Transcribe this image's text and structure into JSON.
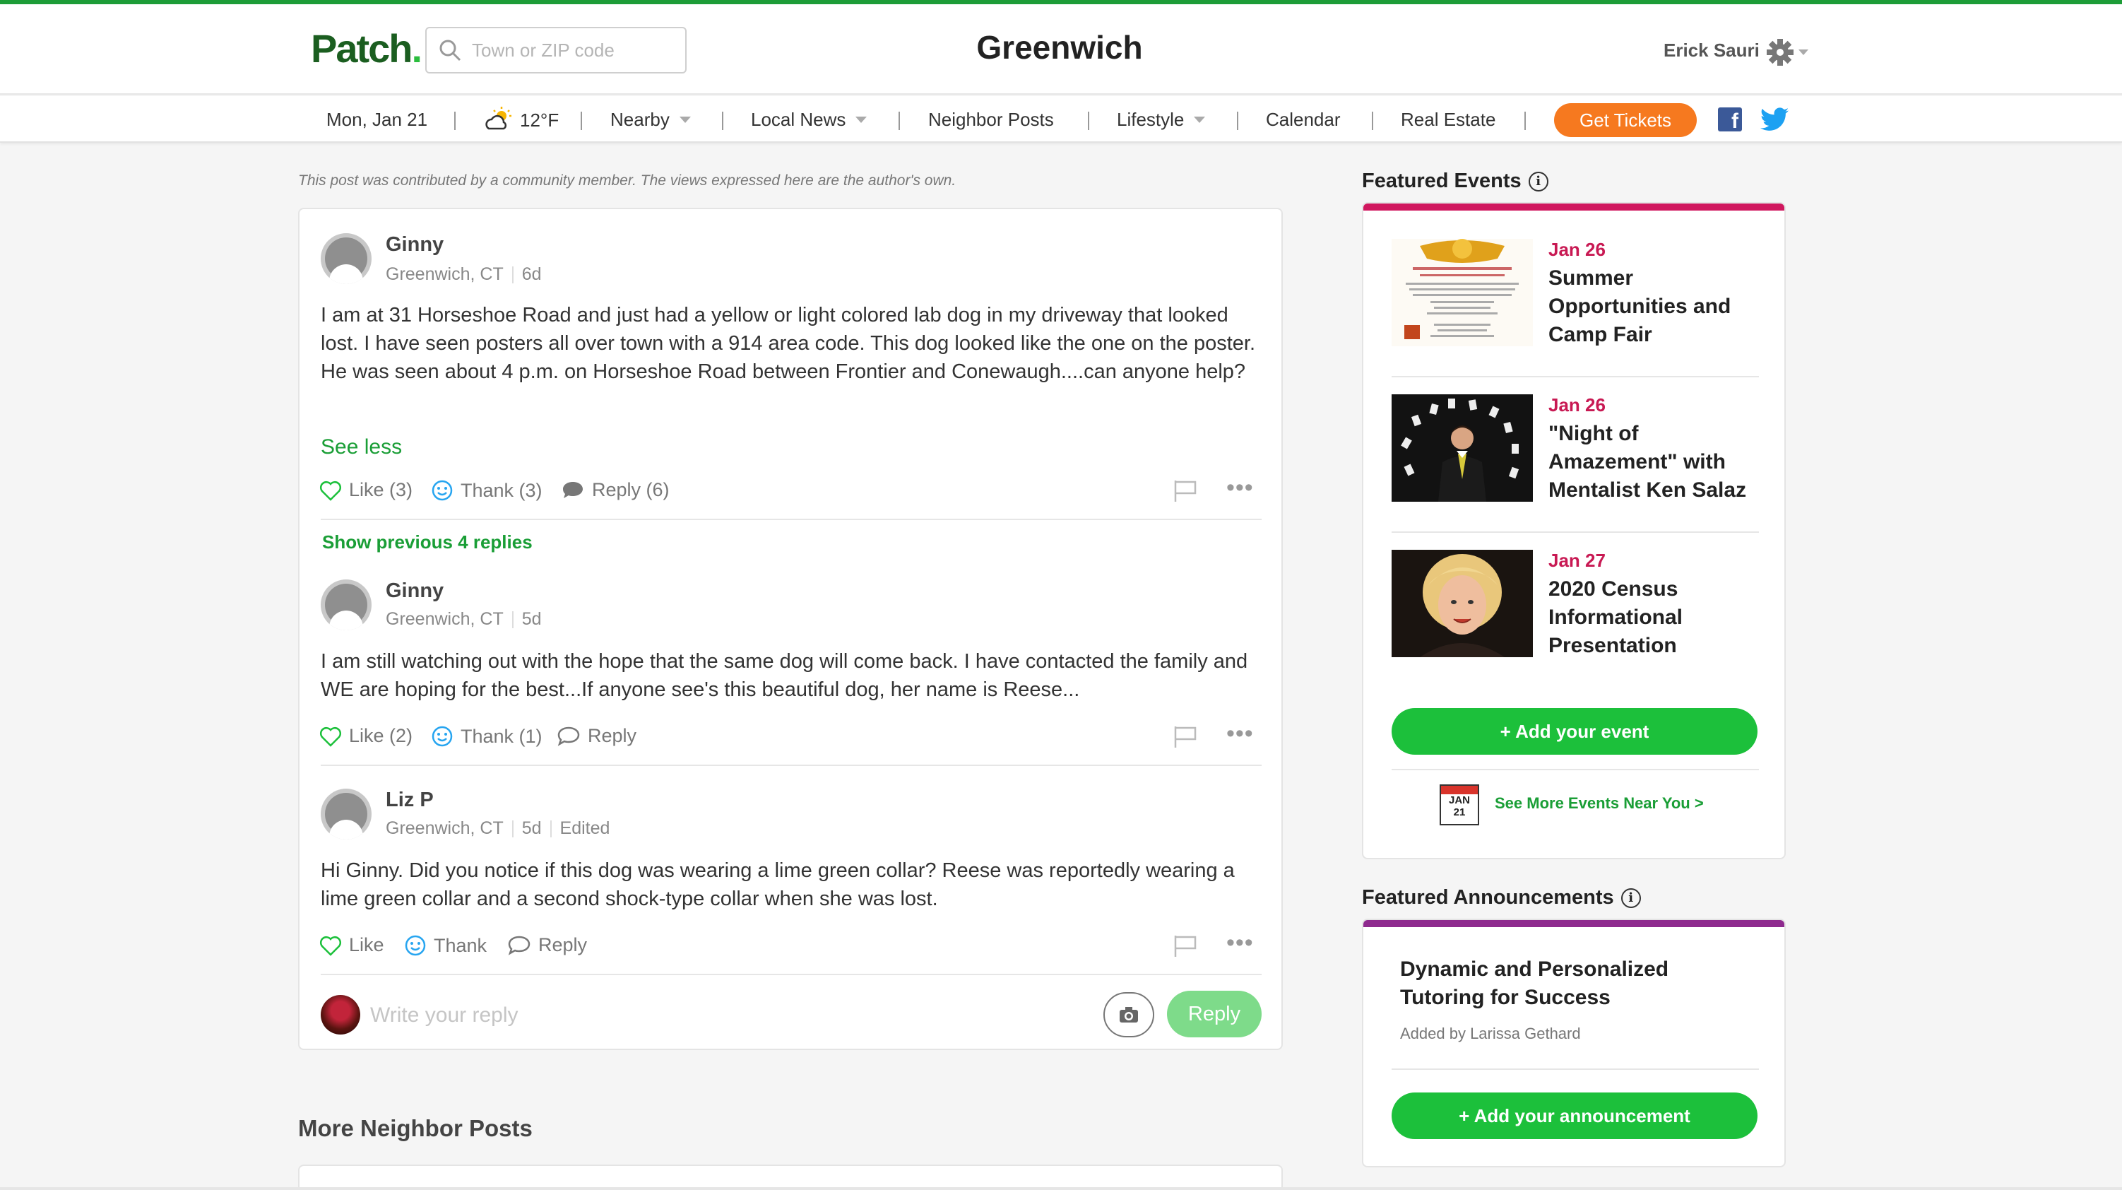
{
  "header": {
    "logo": "Patch",
    "logo_dot": ".",
    "search_placeholder": "Town or ZIP code",
    "site_title": "Greenwich",
    "user_name": "Erick Sauri"
  },
  "nav": {
    "date": "Mon, Jan 21",
    "weather": "12°F",
    "nearby": "Nearby",
    "local_news": "Local News",
    "neighbor_posts": "Neighbor Posts",
    "lifestyle": "Lifestyle",
    "calendar": "Calendar",
    "real_estate": "Real Estate",
    "tickets": "Get Tickets",
    "facebook_glyph": "f"
  },
  "disclaimer": "This post was contributed by a community member. The views expressed here are the author's own.",
  "post": {
    "author": "Ginny",
    "location": "Greenwich, CT",
    "age": "6d",
    "body": "I am at 31 Horseshoe Road and just had a yellow or light colored lab dog in my driveway that looked lost. I have seen posters all over town with a 914 area code. This dog looked like the one on the poster. He was seen about 4 p.m. on Horseshoe Road between Frontier and Conewaugh....can anyone help?",
    "see_less": "See less",
    "like": "Like (3)",
    "thank": "Thank (3)",
    "reply": "Reply (6)",
    "more": "•••"
  },
  "show_previous": "Show previous 4 replies",
  "replies": [
    {
      "author": "Ginny",
      "location": "Greenwich, CT",
      "age": "5d",
      "edited": "",
      "body": "I am still watching out with the hope that the same dog will come back. I have contacted the family and WE are hoping for the best...If anyone see's this beautiful dog, her name is Reese...",
      "like": "Like (2)",
      "thank": "Thank (1)",
      "reply": "Reply",
      "more": "•••"
    },
    {
      "author": "Liz P",
      "location": "Greenwich, CT",
      "age": "5d",
      "edited": "Edited",
      "body": "Hi Ginny. Did you notice if this dog was wearing a lime green collar? Reese was reportedly wearing a lime green collar and a second shock-type collar when she was lost.",
      "like": "Like",
      "thank": "Thank",
      "reply": "Reply",
      "more": "•••"
    }
  ],
  "reply_box": {
    "placeholder": "Write your reply",
    "button": "Reply"
  },
  "more_heading": "More Neighbor Posts",
  "featured_events": {
    "heading": "Featured Events",
    "info": "i",
    "events": [
      {
        "date": "Jan 26",
        "title": "Summer Opportunities and Camp Fair"
      },
      {
        "date": "Jan 26",
        "title": "\"Night of Amazement\" with Mentalist Ken Salaz"
      },
      {
        "date": "Jan 27",
        "title": "2020 Census Informational Presentation"
      }
    ],
    "add_button": "+ Add your event",
    "calendar_month": "JAN",
    "calendar_day": "21",
    "see_more": "See More Events Near You >"
  },
  "featured_announcements": {
    "heading": "Featured Announcements",
    "info": "i",
    "title": "Dynamic and Personalized Tutoring for Success",
    "added_by": "Added by Larissa Gethard",
    "add_button": "+ Add your announcement"
  },
  "colors": {
    "brand_green": "#1d9c37",
    "link_green": "#1a9e36",
    "button_green": "#1cc03b",
    "tickets_orange": "#f6791f",
    "events_accent": "#d0175e",
    "announcements_accent": "#8e2a8e"
  },
  "icons": {
    "search": "search-icon",
    "settings": "gear-icon",
    "weather": "partly-sunny-icon",
    "like": "heart-icon",
    "thank": "smiley-icon",
    "reply": "speech-bubble-icon",
    "report": "flag-icon",
    "camera": "camera-icon"
  }
}
